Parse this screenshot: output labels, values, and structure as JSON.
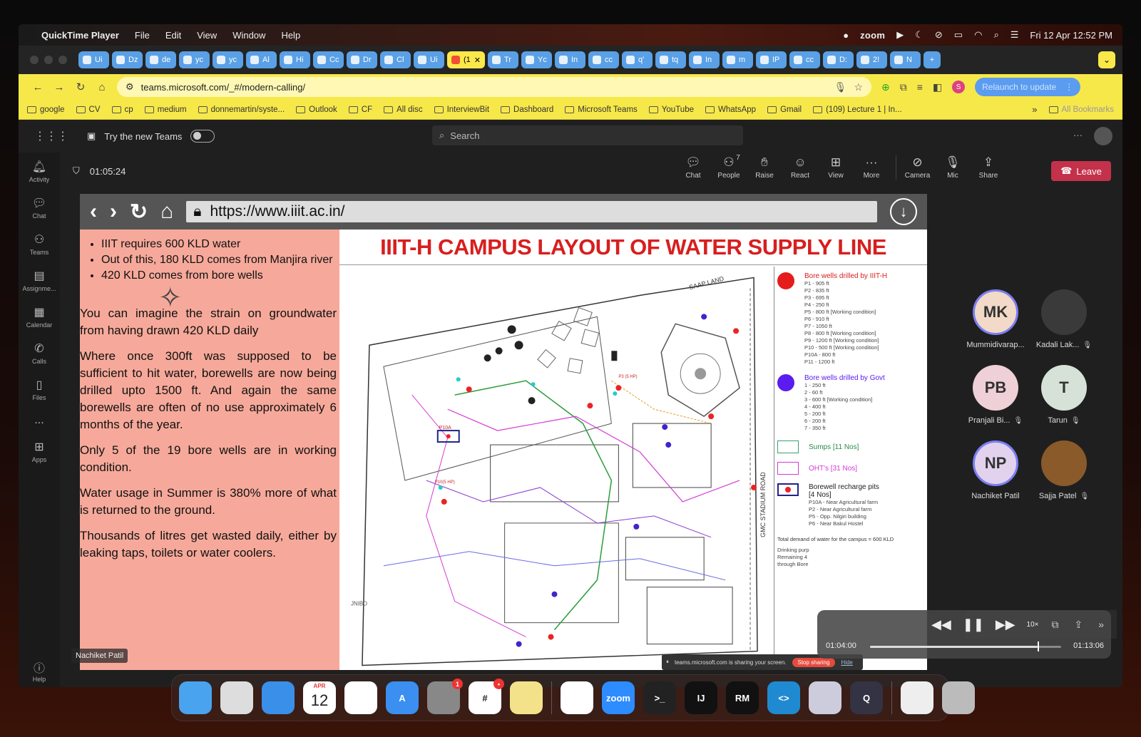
{
  "menubar": {
    "app": "QuickTime Player",
    "menus": [
      "File",
      "Edit",
      "View",
      "Window",
      "Help"
    ],
    "zoom_label": "zoom",
    "datetime": "Fri 12 Apr  12:52 PM"
  },
  "tabs": [
    "Ui",
    "Dz",
    "de",
    "yc",
    "yc",
    "Al",
    "Hi",
    "Cc",
    "Dr",
    "Cl",
    "Ui",
    "(1",
    "Tr",
    "Yc",
    "In",
    "cc",
    "q'",
    "tq",
    "In",
    "m",
    "IP",
    "cc",
    "D:",
    "2!",
    "N"
  ],
  "addressbar": {
    "url": "teams.microsoft.com/_#/modern-calling/",
    "relaunch": "Relaunch to update",
    "profile_initial": "S"
  },
  "bookmarks": [
    "google",
    "CV",
    "cp",
    "medium",
    "donnemartin/syste...",
    "Outlook",
    "CF",
    "All disc",
    "InterviewBit",
    "Dashboard",
    "Microsoft Teams",
    "YouTube",
    "WhatsApp",
    "Gmail",
    "(109) Lecture 1 | In..."
  ],
  "bookmarks_all": "All Bookmarks",
  "teams": {
    "try_new": "Try the new Teams",
    "search_placeholder": "Search",
    "rail": [
      "Activity",
      "Chat",
      "Teams",
      "Assignme...",
      "Calendar",
      "Calls",
      "Files",
      "...",
      "Apps"
    ],
    "help": "Help"
  },
  "meeting": {
    "timer": "01:05:24",
    "controls": [
      {
        "label": "Chat",
        "icon": "chat-icon"
      },
      {
        "label": "People",
        "icon": "people-icon",
        "count": "7"
      },
      {
        "label": "Raise",
        "icon": "hand-icon"
      },
      {
        "label": "React",
        "icon": "smile-icon"
      },
      {
        "label": "View",
        "icon": "view-icon"
      },
      {
        "label": "More",
        "icon": "more-icon"
      },
      {
        "label": "Camera",
        "icon": "camera-off-icon"
      },
      {
        "label": "Mic",
        "icon": "mic-off-icon"
      },
      {
        "label": "Share",
        "icon": "share-icon"
      }
    ],
    "leave": "Leave"
  },
  "shared": {
    "url": "https://www.iiit.ac.in/",
    "bullets": [
      "IIIT requires 600 KLD water",
      "Out of this, 180 KLD comes from Manjira river",
      "420 KLD comes from bore wells"
    ],
    "paragraphs": [
      "You can imagine the strain on groundwater from having drawn 420 KLD daily",
      "Where once 300ft was supposed to be sufficient to hit water, borewells are now being drilled upto 1500 ft. And again the same borewells are often of no use approximately 6 months of the year.",
      "Only 5 of the 19 bore wells are in working condition.",
      "Water usage in Summer is 380% more of what is returned to the ground.",
      "Thousands of litres get wasted daily, either by leaking taps, toilets or water coolers."
    ],
    "map_title": "IIIT-H CAMPUS LAYOUT OF WATER SUPPLY LINE",
    "map_labels": {
      "saap": "SAAP LAND",
      "road": "GMC STADIUM ROAD",
      "jnibd": "JNIBD",
      "p10a": "P10A",
      "p10": "P10(5 HP)",
      "p3": "P3 (5 HP)"
    },
    "legend": {
      "iiit_title": "Bore wells drilled by IIIT-H",
      "iiit_items": [
        "P1 - 905 ft",
        "P2 - 835 ft",
        "P3 - 695 ft",
        "P4 - 250 ft",
        "P5 - 800 ft [Working condition]",
        "P6 - 910 ft",
        "P7 - 1050 ft",
        "P8 - 800 ft [Working condition]",
        "P9 - 1200 ft [Working condition]",
        "P10 - 500 ft [Working condition]",
        "P10A - 800 ft",
        "P11 - 1200 ft"
      ],
      "govt_title": "Bore wells drilled by Govt",
      "govt_items": [
        "1 - 250 ft",
        "2 - 60 ft",
        "3 - 600 ft [Working condition]",
        "4 - 400 ft",
        "5 - 200 ft",
        "6 - 200 ft",
        "7 - 350 ft"
      ],
      "sumps": "Sumps [11 Nos]",
      "ohts": "OHT's [31 Nos]",
      "pits_title": "Borewell recharge pits",
      "pits_count": "[4 Nos]",
      "pits_items": [
        "P10A - Near Agricultural farm",
        "P2 - Near Agricultural farm",
        "P5 - Opp. Nilgiri building",
        "P6 - Near Bakul Hostel"
      ],
      "demand": "Total demand of water for the campus = 600 KLD",
      "extra": [
        "Drinking purp",
        "Remaining 4",
        "through Bore"
      ]
    },
    "sharing_text": "teams.microsoft.com is sharing your screen.",
    "stop_sharing": "Stop sharing",
    "hide": "Hide",
    "name_tag": "Nachiket Patil"
  },
  "participants": [
    {
      "initials": "MK",
      "name": "Mummidivarap...",
      "muted": false,
      "bg": "#f2d9c8",
      "ring": true
    },
    {
      "initials": "",
      "name": "Kadali Lak...",
      "muted": true,
      "bg": "#3a3a3a",
      "ring": false
    },
    {
      "initials": "PB",
      "name": "Pranjali Bi...",
      "muted": true,
      "bg": "#efd0d6",
      "ring": false
    },
    {
      "initials": "T",
      "name": "Tarun",
      "muted": true,
      "bg": "#d6e2d8",
      "ring": false
    },
    {
      "initials": "NP",
      "name": "Nachiket Patil",
      "muted": false,
      "bg": "#e2d2ee",
      "ring": true
    },
    {
      "initials": "",
      "name": "Sajja Patel",
      "muted": true,
      "bg": "#8a5a2a",
      "ring": false
    }
  ],
  "player": {
    "current": "01:04:00",
    "total": "01:13:06",
    "rate": "10×",
    "progress": 0.875
  },
  "dock": [
    {
      "name": "finder",
      "color": "#4aa3ee",
      "label": ""
    },
    {
      "name": "launchpad",
      "color": "#ddd",
      "label": ""
    },
    {
      "name": "safari",
      "color": "#3a8fe8",
      "label": ""
    },
    {
      "name": "calendar",
      "color": "#fff",
      "label": "12",
      "sub": "APR"
    },
    {
      "name": "notes",
      "color": "#fff",
      "label": ""
    },
    {
      "name": "app-store",
      "color": "#3a8ff0",
      "label": "A"
    },
    {
      "name": "system-settings",
      "color": "#888",
      "label": "",
      "badge": "1"
    },
    {
      "name": "slack",
      "color": "#fff",
      "label": "#",
      "badge": "•"
    },
    {
      "name": "stickies",
      "color": "#f4e28a",
      "label": ""
    },
    {
      "name": "chrome",
      "color": "#fff",
      "label": ""
    },
    {
      "name": "zoom",
      "color": "#2d8cff",
      "label": "zoom"
    },
    {
      "name": "terminal",
      "color": "#222",
      "label": ">_"
    },
    {
      "name": "intellij",
      "color": "#111",
      "label": "IJ"
    },
    {
      "name": "rm",
      "color": "#111",
      "label": "RM"
    },
    {
      "name": "vscode",
      "color": "#1f8ad2",
      "label": "<>"
    },
    {
      "name": "preview",
      "color": "#ccd",
      "label": ""
    },
    {
      "name": "quicktime",
      "color": "#334",
      "label": "Q"
    },
    {
      "name": "document",
      "color": "#eee",
      "label": ""
    },
    {
      "name": "trash",
      "color": "#bbb",
      "label": ""
    }
  ]
}
